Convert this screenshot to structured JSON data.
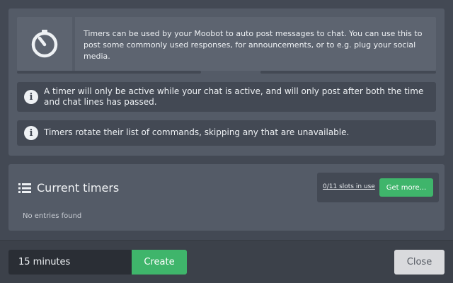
{
  "intro": {
    "icon": "stopwatch-icon",
    "text": "Timers can be used by your Moobot to auto post messages to chat. You can use this to post some commonly used responses, for announcements, or to e.g. plug your social media."
  },
  "notes": [
    {
      "icon": "info-icon",
      "text": "A timer will only be active while your chat is active, and will only post after both the time and chat lines has passed."
    },
    {
      "icon": "info-icon",
      "text": "Timers rotate their list of commands, skipping any that are unavailable."
    }
  ],
  "timers": {
    "icon": "list-icon",
    "title": "Current timers",
    "slots_text": "0/11 slots in use",
    "get_more_label": "Get more...",
    "empty_text": "No entries found"
  },
  "footer": {
    "duration_value": "15 minutes",
    "create_label": "Create",
    "close_label": "Close"
  },
  "colors": {
    "background": "#434954",
    "panel": "#545b67",
    "accent_green": "#3fb56b",
    "close_button": "#d9dadd"
  }
}
